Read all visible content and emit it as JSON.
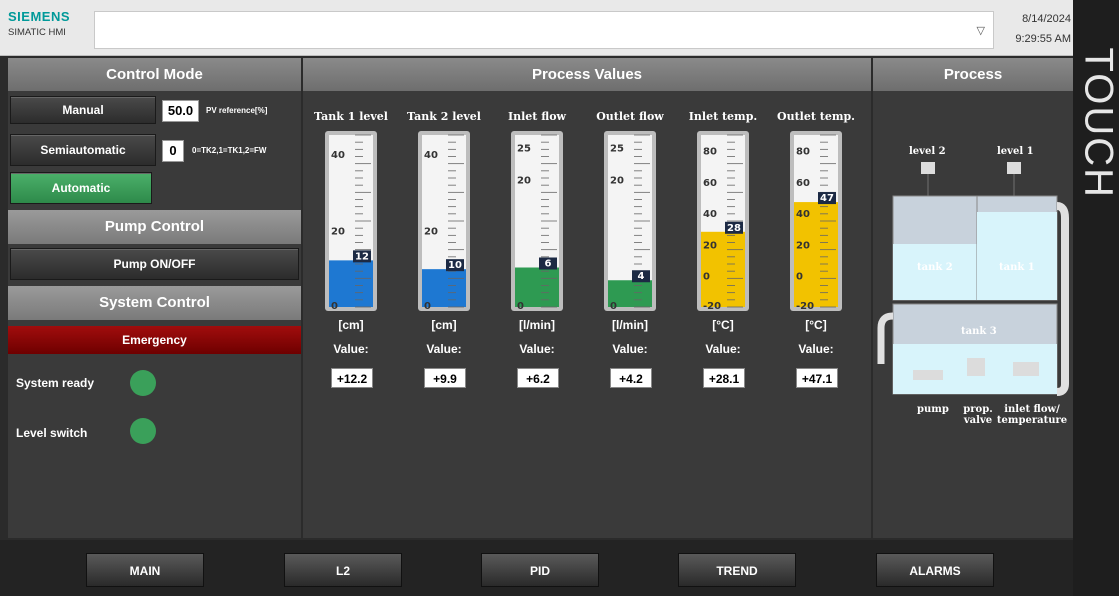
{
  "header": {
    "brand": "SIEMENS",
    "subtitle": "SIMATIC HMI",
    "date": "8/14/2024",
    "time": "9:29:55 AM",
    "side_label": "TOUCH"
  },
  "control": {
    "title": "Control Mode",
    "manual_label": "Manual",
    "semi_label": "Semiautomatic",
    "auto_label": "Automatic",
    "pv_value": "50.0",
    "pv_label": "PV reference[%]",
    "mode_value": "0",
    "mode_hint": "0=TK2,1=TK1,2=FW",
    "pump_title": "Pump Control",
    "pump_button": "Pump ON/OFF",
    "system_title": "System Control",
    "emergency": "Emergency",
    "system_ready": "System ready",
    "level_switch": "Level switch",
    "led_color": "#3aa05a"
  },
  "process_values": {
    "title": "Process Values",
    "value_label": "Value:",
    "gauges": [
      {
        "title": "Tank 1 level",
        "unit": "[cm]",
        "value_text": "+12.2",
        "marker": "12",
        "min": 0,
        "max": 45,
        "value": 12.2,
        "ticks": [
          "40",
          "20",
          "0"
        ],
        "tick_vals": [
          40,
          20,
          0
        ],
        "color": "#1e78d2"
      },
      {
        "title": "Tank 2 level",
        "unit": "[cm]",
        "value_text": "+9.9",
        "marker": "10",
        "min": 0,
        "max": 45,
        "value": 9.9,
        "ticks": [
          "40",
          "20",
          "0"
        ],
        "tick_vals": [
          40,
          20,
          0
        ],
        "color": "#1e78d2"
      },
      {
        "title": "Inlet flow",
        "unit": "[l/min]",
        "value_text": "+6.2",
        "marker": "6",
        "min": 0,
        "max": 27,
        "value": 6.2,
        "ticks": [
          "25",
          "20",
          "0"
        ],
        "tick_vals": [
          25,
          20,
          0
        ],
        "color": "#2e9a52"
      },
      {
        "title": "Outlet flow",
        "unit": "[l/min]",
        "value_text": "+4.2",
        "marker": "4",
        "min": 0,
        "max": 27,
        "value": 4.2,
        "ticks": [
          "25",
          "20",
          "0"
        ],
        "tick_vals": [
          25,
          20,
          0
        ],
        "color": "#2e9a52"
      },
      {
        "title": "Inlet temp.",
        "unit": "[°C]",
        "value_text": "+28.1",
        "marker": "28",
        "min": -20,
        "max": 90,
        "value": 28.1,
        "ticks": [
          "80",
          "60",
          "40",
          "20",
          "0",
          "-20"
        ],
        "tick_vals": [
          80,
          60,
          40,
          20,
          0,
          -20
        ],
        "color": "#f2c200"
      },
      {
        "title": "Outlet temp.",
        "unit": "[°C]",
        "value_text": "+47.1",
        "marker": "47",
        "min": -20,
        "max": 90,
        "value": 47.1,
        "ticks": [
          "80",
          "60",
          "40",
          "20",
          "0",
          "-20"
        ],
        "tick_vals": [
          80,
          60,
          40,
          20,
          0,
          -20
        ],
        "color": "#f2c200"
      }
    ]
  },
  "process": {
    "title": "Process",
    "level2": "level 2",
    "level1": "level 1",
    "tank2": "tank 2",
    "tank1": "tank 1",
    "tank3": "tank 3",
    "pump": "pump",
    "prop_valve": "prop. valve",
    "inlet_flow": "inlet flow/ temperature"
  },
  "nav": [
    "MAIN",
    "L2",
    "PID",
    "TREND",
    "ALARMS"
  ]
}
